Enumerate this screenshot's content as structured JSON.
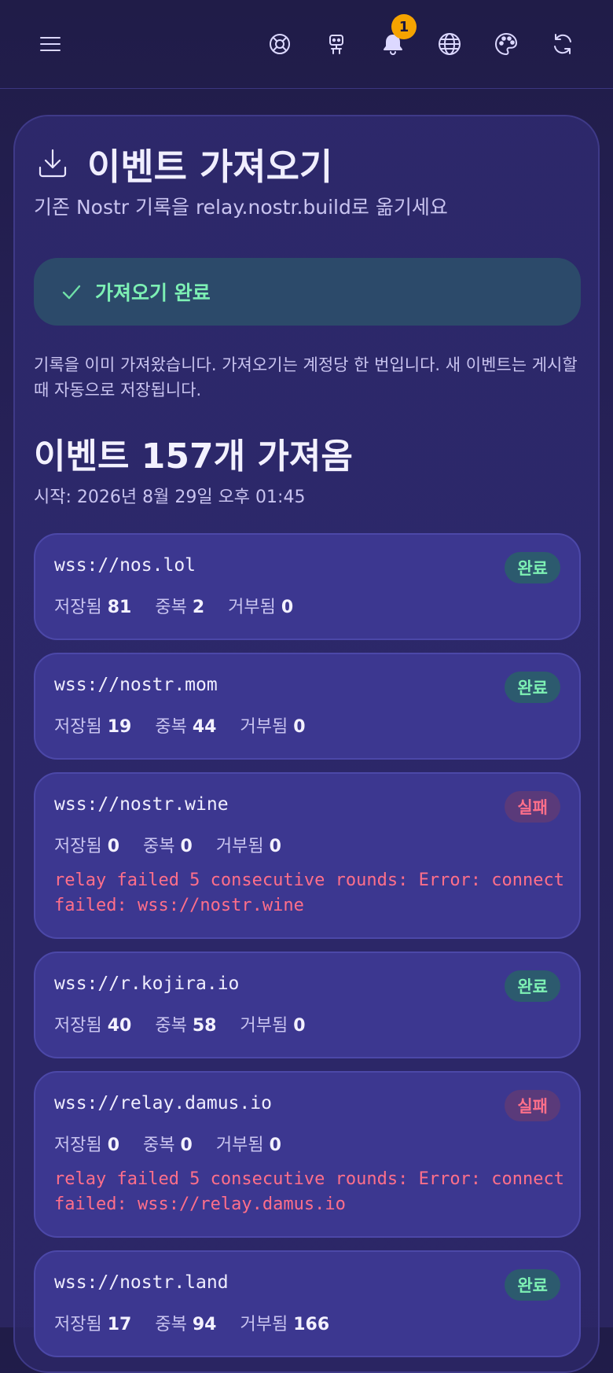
{
  "topbar": {
    "notification_count": "1",
    "icons": [
      "menu-icon",
      "support-icon",
      "robot-icon",
      "bell-icon",
      "globe-icon",
      "palette-icon",
      "refresh-icon"
    ]
  },
  "page": {
    "title": "이벤트 가져오기",
    "subtitle": "기존 Nostr 기록을 relay.nostr.build로 옮기세요"
  },
  "status_banner": {
    "text": "가져오기 완료"
  },
  "notice": "기록을 이미 가져왔습니다. 가져오기는 계정당 한 번입니다. 새 이벤트는 게시할 때 자동으로 저장됩니다.",
  "summary": {
    "title": "이벤트 157개 가져옴",
    "started": "시작: 2026년 8월 29일 오후 01:45"
  },
  "labels": {
    "saved": "저장됨",
    "duplicate": "중복",
    "rejected": "거부됨"
  },
  "relays": [
    {
      "url": "wss://nos.lol",
      "status": "완료",
      "saved": "81",
      "duplicate": "2",
      "rejected": "0",
      "error": ""
    },
    {
      "url": "wss://nostr.mom",
      "status": "완료",
      "saved": "19",
      "duplicate": "44",
      "rejected": "0",
      "error": ""
    },
    {
      "url": "wss://nostr.wine",
      "status": "실패",
      "saved": "0",
      "duplicate": "0",
      "rejected": "0",
      "error": "relay failed 5 consecutive rounds: Error: connect failed: wss://nostr.wine"
    },
    {
      "url": "wss://r.kojira.io",
      "status": "완료",
      "saved": "40",
      "duplicate": "58",
      "rejected": "0",
      "error": ""
    },
    {
      "url": "wss://relay.damus.io",
      "status": "실패",
      "saved": "0",
      "duplicate": "0",
      "rejected": "0",
      "error": "relay failed 5 consecutive rounds: Error: connect failed: wss://relay.damus.io"
    },
    {
      "url": "wss://nostr.land",
      "status": "완료",
      "saved": "17",
      "duplicate": "94",
      "rejected": "166",
      "error": ""
    }
  ],
  "colors": {
    "success": "#7df0b4",
    "failure": "#ff6f8a",
    "badge": "#f5a300"
  }
}
